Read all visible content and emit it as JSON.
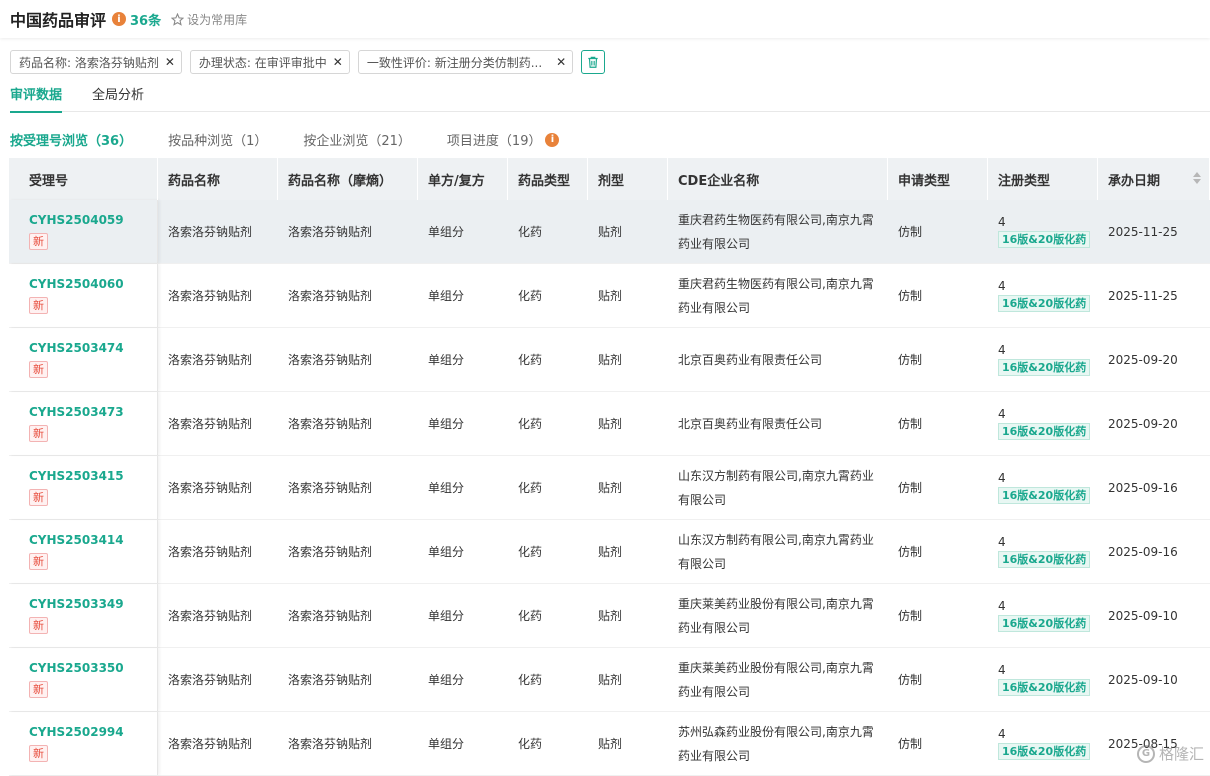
{
  "header": {
    "title": "中国药品审评",
    "count": "36条",
    "favorite_label": "设为常用库"
  },
  "filters": [
    {
      "label": "药品名称: 洛索洛芬钠贴剂"
    },
    {
      "label": "办理状态: 在审评审批中"
    },
    {
      "label": "一致性评价: 新注册分类仿制药..."
    }
  ],
  "tabs": [
    {
      "label": "审评数据"
    },
    {
      "label": "全局分析"
    }
  ],
  "subtabs": [
    {
      "label": "按受理号浏览（36）"
    },
    {
      "label": "按品种浏览（1）"
    },
    {
      "label": "按企业浏览（21）"
    },
    {
      "label": "项目进度（19）"
    }
  ],
  "columns": [
    "受理号",
    "药品名称",
    "药品名称（摩熵）",
    "单方/复方",
    "药品类型",
    "剂型",
    "CDE企业名称",
    "申请类型",
    "注册类型",
    "承办日期"
  ],
  "rows": [
    {
      "acc": "CYHS2504059",
      "badge": "新",
      "name": "洛索洛芬钠贴剂",
      "name2": "洛索洛芬钠贴剂",
      "combo": "单组分",
      "type": "化药",
      "form": "贴剂",
      "company": "重庆君药生物医药有限公司,南京九霄药业有限公司",
      "apply": "仿制",
      "reg_num": "4",
      "reg_tag": "16版&20版化药",
      "date": "2025-11-25"
    },
    {
      "acc": "CYHS2504060",
      "badge": "新",
      "name": "洛索洛芬钠贴剂",
      "name2": "洛索洛芬钠贴剂",
      "combo": "单组分",
      "type": "化药",
      "form": "贴剂",
      "company": "重庆君药生物医药有限公司,南京九霄药业有限公司",
      "apply": "仿制",
      "reg_num": "4",
      "reg_tag": "16版&20版化药",
      "date": "2025-11-25"
    },
    {
      "acc": "CYHS2503474",
      "badge": "新",
      "name": "洛索洛芬钠贴剂",
      "name2": "洛索洛芬钠贴剂",
      "combo": "单组分",
      "type": "化药",
      "form": "贴剂",
      "company": "北京百奥药业有限责任公司",
      "apply": "仿制",
      "reg_num": "4",
      "reg_tag": "16版&20版化药",
      "date": "2025-09-20"
    },
    {
      "acc": "CYHS2503473",
      "badge": "新",
      "name": "洛索洛芬钠贴剂",
      "name2": "洛索洛芬钠贴剂",
      "combo": "单组分",
      "type": "化药",
      "form": "贴剂",
      "company": "北京百奥药业有限责任公司",
      "apply": "仿制",
      "reg_num": "4",
      "reg_tag": "16版&20版化药",
      "date": "2025-09-20"
    },
    {
      "acc": "CYHS2503415",
      "badge": "新",
      "name": "洛索洛芬钠贴剂",
      "name2": "洛索洛芬钠贴剂",
      "combo": "单组分",
      "type": "化药",
      "form": "贴剂",
      "company": "山东汉方制药有限公司,南京九霄药业有限公司",
      "apply": "仿制",
      "reg_num": "4",
      "reg_tag": "16版&20版化药",
      "date": "2025-09-16"
    },
    {
      "acc": "CYHS2503414",
      "badge": "新",
      "name": "洛索洛芬钠贴剂",
      "name2": "洛索洛芬钠贴剂",
      "combo": "单组分",
      "type": "化药",
      "form": "贴剂",
      "company": "山东汉方制药有限公司,南京九霄药业有限公司",
      "apply": "仿制",
      "reg_num": "4",
      "reg_tag": "16版&20版化药",
      "date": "2025-09-16"
    },
    {
      "acc": "CYHS2503349",
      "badge": "新",
      "name": "洛索洛芬钠贴剂",
      "name2": "洛索洛芬钠贴剂",
      "combo": "单组分",
      "type": "化药",
      "form": "贴剂",
      "company": "重庆莱美药业股份有限公司,南京九霄药业有限公司",
      "apply": "仿制",
      "reg_num": "4",
      "reg_tag": "16版&20版化药",
      "date": "2025-09-10"
    },
    {
      "acc": "CYHS2503350",
      "badge": "新",
      "name": "洛索洛芬钠贴剂",
      "name2": "洛索洛芬钠贴剂",
      "combo": "单组分",
      "type": "化药",
      "form": "贴剂",
      "company": "重庆莱美药业股份有限公司,南京九霄药业有限公司",
      "apply": "仿制",
      "reg_num": "4",
      "reg_tag": "16版&20版化药",
      "date": "2025-09-10"
    },
    {
      "acc": "CYHS2502994",
      "badge": "新",
      "name": "洛索洛芬钠贴剂",
      "name2": "洛索洛芬钠贴剂",
      "combo": "单组分",
      "type": "化药",
      "form": "贴剂",
      "company": "苏州弘森药业股份有限公司,南京九霄药业有限公司",
      "apply": "仿制",
      "reg_num": "4",
      "reg_tag": "16版&20版化药",
      "date": "2025-08-15"
    }
  ],
  "watermark": "格隆汇",
  "colors": {
    "accent": "#1aa88e",
    "new_badge": "#e74c3c",
    "info": "#e8823a"
  }
}
